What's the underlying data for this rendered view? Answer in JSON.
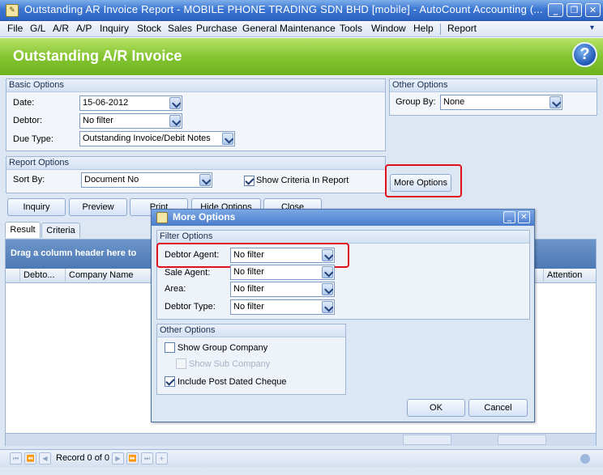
{
  "window": {
    "title": "Outstanding AR Invoice Report - MOBILE PHONE TRADING SDN BHD [mobile] - AutoCount Accounting (...",
    "controls": [
      "minimize-icon",
      "restore-icon",
      "close-icon"
    ]
  },
  "menu": {
    "items": [
      "File",
      "G/L",
      "A/R",
      "A/P",
      "Inquiry",
      "Stock",
      "Sales",
      "Purchase",
      "General Maintenance",
      "Tools",
      "Window",
      "Help",
      "Report"
    ]
  },
  "header": {
    "title": "Outstanding A/R Invoice",
    "help_icon": "?"
  },
  "basic_options": {
    "title": "Basic Options",
    "date_label": "Date:",
    "date_value": "15-06-2012",
    "debtor_label": "Debtor:",
    "debtor_value": "No filter",
    "due_type_label": "Due Type:",
    "due_type_value": "Outstanding Invoice/Debit Notes"
  },
  "other_options": {
    "title": "Other Options",
    "group_by_label": "Group By:",
    "group_by_value": "None"
  },
  "report_options": {
    "title": "Report Options",
    "sort_by_label": "Sort By:",
    "sort_by_value": "Document No",
    "show_criteria_label": "Show Criteria In Report",
    "show_criteria_checked": true
  },
  "more_options_button": "More Options",
  "actions": {
    "inquiry": "Inquiry",
    "preview": "Preview",
    "print": "Print",
    "hide_options": "Hide Options",
    "close": "Close"
  },
  "tabs": [
    {
      "label": "Result",
      "active": true
    },
    {
      "label": "Criteria",
      "active": false
    }
  ],
  "grid": {
    "group_band_text": "Drag a column header here to",
    "columns": [
      "Debto...",
      "Company Name",
      "Attention"
    ]
  },
  "navigator": {
    "record_text": "Record 0 of 0"
  },
  "dialog": {
    "title": "More Options",
    "filter_options": {
      "title": "Filter Options",
      "debtor_agent_label": "Debtor Agent:",
      "debtor_agent_value": "No filter",
      "sale_agent_label": "Sale Agent:",
      "sale_agent_value": "No filter",
      "area_label": "Area:",
      "area_value": "No filter",
      "debtor_type_label": "Debtor Type:",
      "debtor_type_value": "No filter"
    },
    "other_options": {
      "title": "Other Options",
      "show_group_company": "Show Group Company",
      "show_group_company_checked": false,
      "show_sub_company": "Show Sub Company",
      "show_sub_company_checked": false,
      "include_post_dated_cheque": "Include Post Dated Cheque",
      "include_post_dated_cheque_checked": true
    },
    "ok": "OK",
    "cancel": "Cancel"
  },
  "colors": {
    "highlight": "#e2101c",
    "header_green": "#85c531",
    "titlebar_blue": "#3d77d3"
  }
}
